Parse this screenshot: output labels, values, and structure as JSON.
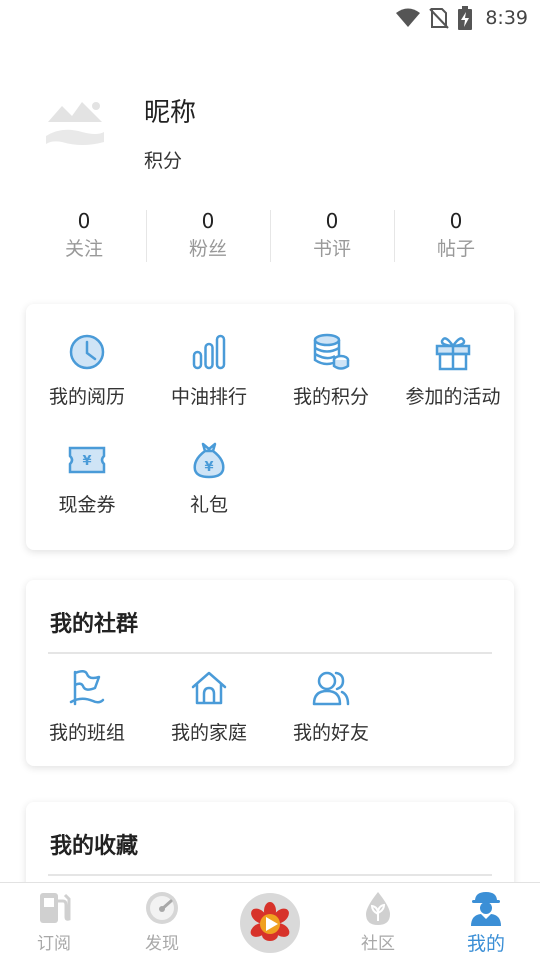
{
  "status_bar": {
    "time": "8:39"
  },
  "profile": {
    "nickname": "昵称",
    "points_label": "积分"
  },
  "stats": [
    {
      "value": "0",
      "label": "关注"
    },
    {
      "value": "0",
      "label": "粉丝"
    },
    {
      "value": "0",
      "label": "书评"
    },
    {
      "value": "0",
      "label": "帖子"
    }
  ],
  "features": [
    {
      "label": "我的阅历",
      "icon": "clock-icon"
    },
    {
      "label": "中油排行",
      "icon": "ranking-bars-icon"
    },
    {
      "label": "我的积分",
      "icon": "coin-stack-icon"
    },
    {
      "label": "参加的活动",
      "icon": "gift-icon"
    },
    {
      "label": "现金券",
      "icon": "voucher-icon"
    },
    {
      "label": "礼包",
      "icon": "money-bag-icon"
    }
  ],
  "community": {
    "title": "我的社群",
    "items": [
      {
        "label": "我的班组",
        "icon": "flag-icon"
      },
      {
        "label": "我的家庭",
        "icon": "home-icon"
      },
      {
        "label": "我的好友",
        "icon": "friends-icon"
      }
    ]
  },
  "favorites": {
    "title": "我的收藏"
  },
  "tabbar": {
    "items": [
      {
        "label": "订阅",
        "icon": "fuel-pump-icon",
        "active": false
      },
      {
        "label": "发现",
        "icon": "speedometer-icon",
        "active": false
      },
      {
        "label": "",
        "icon": "play-logo-icon",
        "active": false
      },
      {
        "label": "社区",
        "icon": "drop-leaf-icon",
        "active": false
      },
      {
        "label": "我的",
        "icon": "worker-avatar-icon",
        "active": true
      }
    ]
  },
  "colors": {
    "accent": "#3b8fd6",
    "icon_blue": "#4a9bd8",
    "muted": "#999999"
  }
}
